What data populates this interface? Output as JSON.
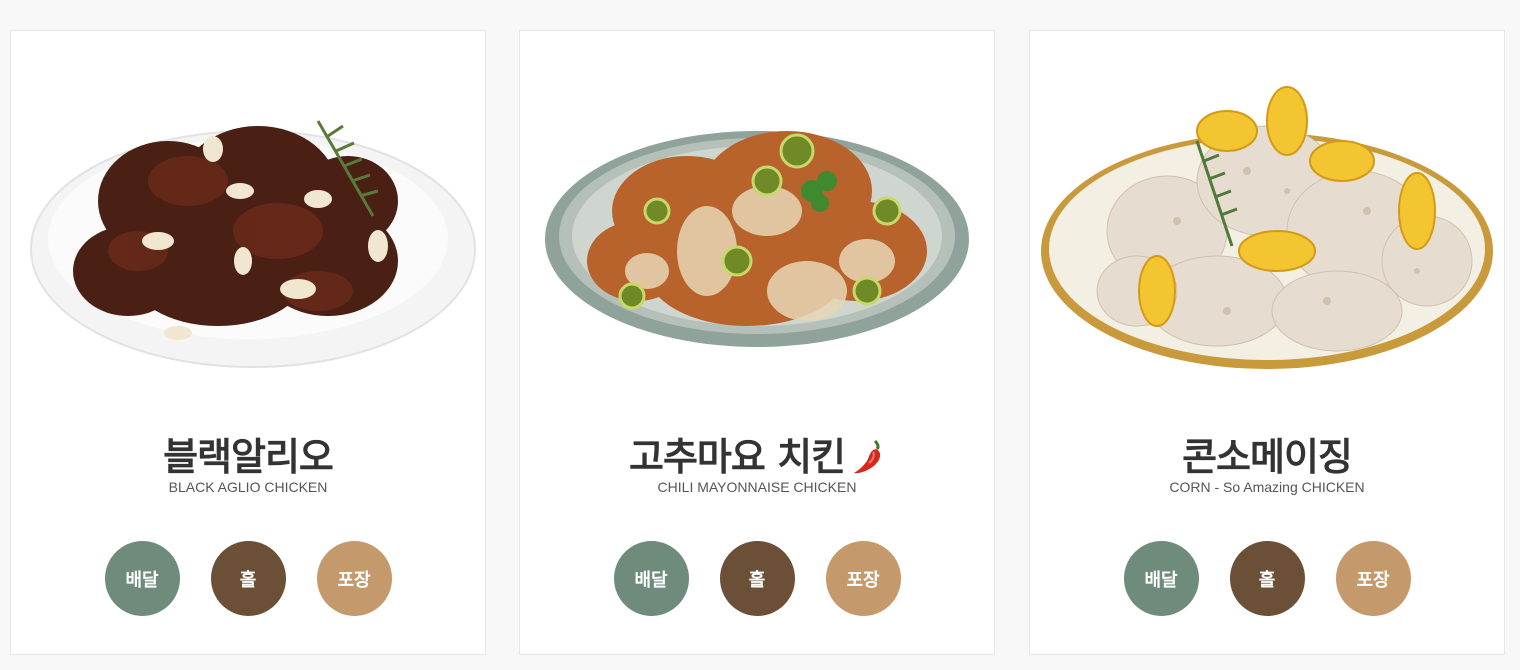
{
  "colors": {
    "delivery": "#6e8b7c",
    "hall": "#6b4f37",
    "takeout": "#c4996b"
  },
  "menu": [
    {
      "name": "블랙알리오",
      "subtitle": "BLACK AGLIO CHICKEN",
      "spicy": false,
      "buttons": {
        "delivery": "배달",
        "hall": "홀",
        "takeout": "포장"
      }
    },
    {
      "name": "고추마요 치킨",
      "subtitle": "CHILI MAYONNAISE CHICKEN",
      "spicy": true,
      "buttons": {
        "delivery": "배달",
        "hall": "홀",
        "takeout": "포장"
      }
    },
    {
      "name": "콘소메이징",
      "subtitle": "CORN - So Amazing CHICKEN",
      "spicy": false,
      "buttons": {
        "delivery": "배달",
        "hall": "홀",
        "takeout": "포장"
      }
    }
  ]
}
